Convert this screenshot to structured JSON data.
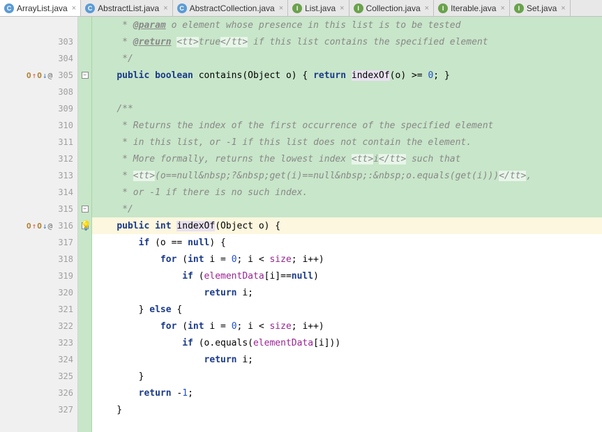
{
  "tabs": [
    {
      "icon": "c",
      "label": "ArrayList.java",
      "active": true
    },
    {
      "icon": "c",
      "label": "AbstractList.java",
      "active": false
    },
    {
      "icon": "c",
      "label": "AbstractCollection.java",
      "active": false
    },
    {
      "icon": "i",
      "label": "List.java",
      "active": false
    },
    {
      "icon": "i",
      "label": "Collection.java",
      "active": false
    },
    {
      "icon": "i",
      "label": "Iterable.java",
      "active": false
    },
    {
      "icon": "i",
      "label": "Set.java",
      "active": false
    }
  ],
  "lines": [
    {
      "n": "",
      "bg": "green",
      "html": "     <span class='c-cmt'>* </span><span class='c-doc'>@param</span><span class='c-cmt'> o element whose presence in this list is to be tested</span>"
    },
    {
      "n": "303",
      "bg": "green",
      "html": "     <span class='c-cmt'>* </span><span class='c-doc'>@return</span><span class='c-cmt'> </span><span class='c-tag'>&lt;tt&gt;</span><span class='c-cmt'>true</span><span class='c-tag'>&lt;/tt&gt;</span><span class='c-cmt'> if this list contains the specified element</span>"
    },
    {
      "n": "304",
      "bg": "green",
      "html": "     <span class='c-cmt'>*/</span>"
    },
    {
      "n": "305",
      "bg": "green",
      "marks": true,
      "fold": "-",
      "html": "    <span class='c-kw'>public boolean</span> contains(Object o) { <span class='c-kw'>return</span> <span class='c-call'>indexOf</span>(o) &gt;= <span class='c-num'>0</span>; }"
    },
    {
      "n": "308",
      "bg": "green",
      "html": ""
    },
    {
      "n": "309",
      "bg": "green",
      "html": "    <span class='c-cmt'>/**</span>"
    },
    {
      "n": "310",
      "bg": "green",
      "html": "     <span class='c-cmt'>* Returns the index of the first occurrence of the specified element</span>"
    },
    {
      "n": "311",
      "bg": "green",
      "html": "     <span class='c-cmt'>* in this list, or -1 if this list does not contain the element.</span>"
    },
    {
      "n": "312",
      "bg": "green",
      "html": "     <span class='c-cmt'>* More formally, returns the lowest index </span><span class='c-tag'>&lt;tt&gt;</span><span class='c-cmt'>i</span><span class='c-tag'>&lt;/tt&gt;</span><span class='c-cmt'> such that</span>"
    },
    {
      "n": "313",
      "bg": "green",
      "html": "     <span class='c-cmt'>* </span><span class='c-tag'>&lt;tt&gt;</span><span class='c-cmt'>(o==null&amp;nbsp;?&amp;nbsp;get(i)==null&amp;nbsp;:&amp;nbsp;o.equals(get(i)))</span><span class='c-tag'>&lt;/tt&gt;</span><span class='c-cmt'>,</span>"
    },
    {
      "n": "314",
      "bg": "green",
      "html": "     <span class='c-cmt'>* or -1 if there is no such index.</span>"
    },
    {
      "n": "315",
      "bg": "green",
      "fold": "-",
      "html": "     <span class='c-cmt'>*/</span>"
    },
    {
      "n": "316",
      "bg": "hl",
      "marks": true,
      "bulb": true,
      "fold": "-",
      "html": "    <span class='c-kw'>public int</span> <span class='c-call'>indexOf</span>(Object o) {"
    },
    {
      "n": "317",
      "bg": "",
      "html": "        <span class='c-kw'>if</span> (o == <span class='c-kw'>null</span>) {"
    },
    {
      "n": "318",
      "bg": "",
      "html": "            <span class='c-kw'>for</span> (<span class='c-kw'>int</span> i = <span class='c-num'>0</span>; i &lt; <span class='c-this'>size</span>; i++)"
    },
    {
      "n": "319",
      "bg": "",
      "html": "                <span class='c-kw'>if</span> (<span class='c-this'>elementData</span>[i]==<span class='c-kw'>null</span>)"
    },
    {
      "n": "320",
      "bg": "",
      "html": "                    <span class='c-kw'>return</span> i;"
    },
    {
      "n": "321",
      "bg": "",
      "html": "        } <span class='c-kw'>else</span> {"
    },
    {
      "n": "322",
      "bg": "",
      "html": "            <span class='c-kw'>for</span> (<span class='c-kw'>int</span> i = <span class='c-num'>0</span>; i &lt; <span class='c-this'>size</span>; i++)"
    },
    {
      "n": "323",
      "bg": "",
      "html": "                <span class='c-kw'>if</span> (o.equals(<span class='c-this'>elementData</span>[i]))"
    },
    {
      "n": "324",
      "bg": "",
      "html": "                    <span class='c-kw'>return</span> i;"
    },
    {
      "n": "325",
      "bg": "",
      "html": "        }"
    },
    {
      "n": "326",
      "bg": "",
      "html": "        <span class='c-kw'>return</span> -<span class='c-num'>1</span>;"
    },
    {
      "n": "327",
      "bg": "",
      "html": "    }"
    }
  ]
}
